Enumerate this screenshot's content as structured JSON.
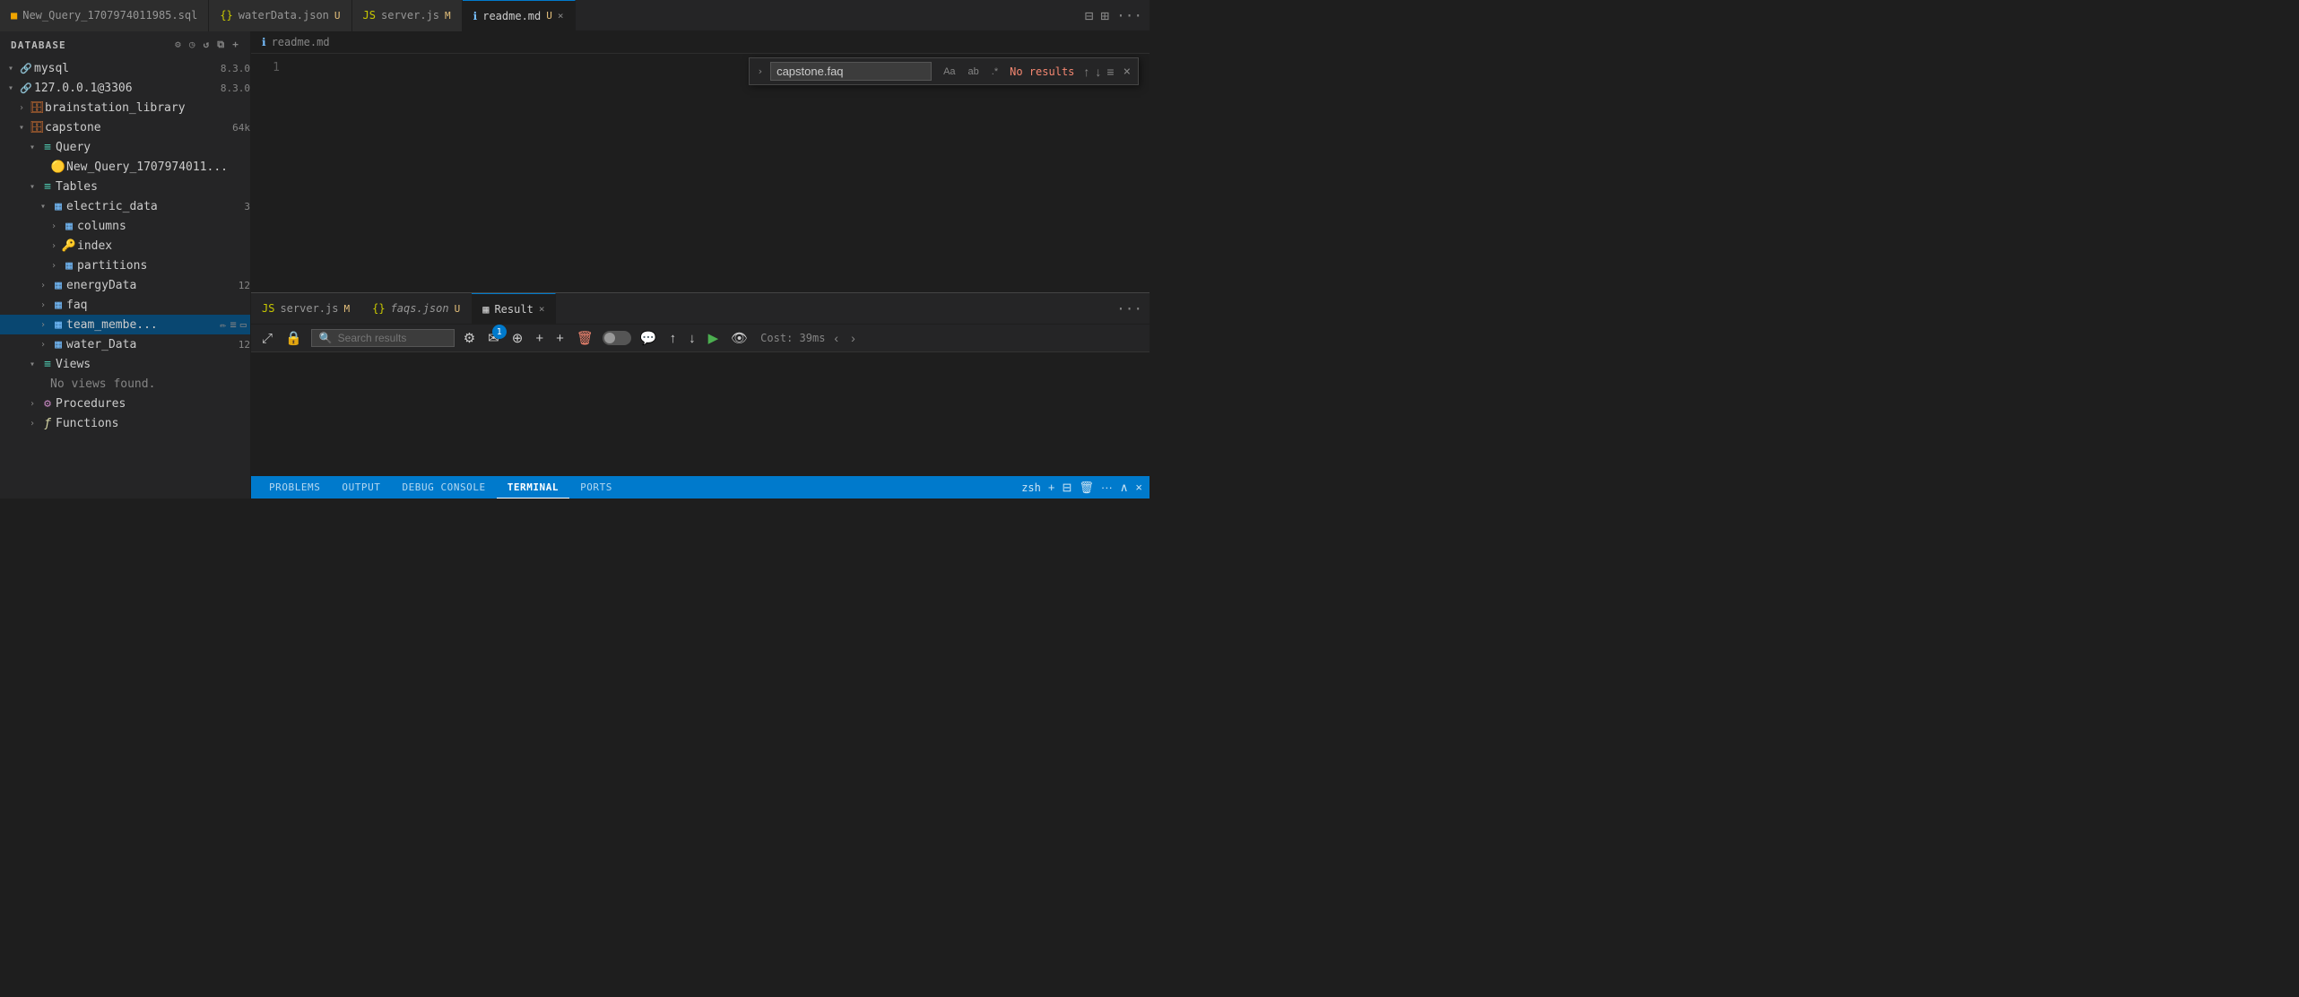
{
  "header": {
    "title": "DATABASE"
  },
  "tabs": [
    {
      "id": "sql-tab",
      "icon": "sql",
      "label": "New_Query_1707974011985.sql",
      "modified": false,
      "active": false
    },
    {
      "id": "json-tab",
      "icon": "json",
      "label": "waterData.json",
      "modified": true,
      "badge": "U",
      "active": false
    },
    {
      "id": "js-tab",
      "icon": "js",
      "label": "server.js",
      "modified": true,
      "badge": "M",
      "active": false
    },
    {
      "id": "readme-tab",
      "icon": "info",
      "label": "readme.md",
      "modified": true,
      "badge": "U",
      "active": true,
      "closable": true
    }
  ],
  "breadcrumb": {
    "icon": "info",
    "text": "readme.md"
  },
  "find_widget": {
    "expand_icon": "›",
    "search_value": "capstone.faq",
    "match_case_label": "Aa",
    "match_word_label": "ab",
    "regex_label": ".*",
    "result_text": "No results",
    "prev_label": "↑",
    "next_label": "↓",
    "list_label": "≡",
    "close_label": "×"
  },
  "editor": {
    "line_1": "1"
  },
  "sidebar": {
    "title": "DATABASE",
    "icons": [
      "⚙",
      "◷",
      "↺",
      "⧉",
      "+"
    ],
    "tree": [
      {
        "level": 0,
        "chevron": "open",
        "icon": "🔗",
        "icon_color": "mysql",
        "label": "mysql",
        "badge": "8.3.0"
      },
      {
        "level": 0,
        "chevron": "open",
        "icon": "🔗",
        "icon_color": "mysql",
        "label": "127.0.0.1@3306",
        "badge": "8.3.0"
      },
      {
        "level": 1,
        "chevron": "closed",
        "icon": "🗄",
        "icon_color": "db",
        "label": "brainstation_library",
        "badge": ""
      },
      {
        "level": 1,
        "chevron": "open",
        "icon": "🗄",
        "icon_color": "db",
        "label": "capstone",
        "badge": "64k"
      },
      {
        "level": 2,
        "chevron": "open",
        "icon": "≡",
        "icon_color": "view",
        "label": "Query",
        "badge": ""
      },
      {
        "level": 3,
        "chevron": "empty",
        "icon": "🟡",
        "icon_color": "query",
        "label": "New_Query_1707974011...",
        "badge": ""
      },
      {
        "level": 2,
        "chevron": "open",
        "icon": "≡",
        "icon_color": "view",
        "label": "Tables",
        "badge": ""
      },
      {
        "level": 3,
        "chevron": "open",
        "icon": "▦",
        "icon_color": "table",
        "label": "electric_data",
        "badge": "3"
      },
      {
        "level": 4,
        "chevron": "closed",
        "icon": "▦",
        "icon_color": "table",
        "label": "columns",
        "badge": ""
      },
      {
        "level": 4,
        "chevron": "closed",
        "icon": "🔑",
        "icon_color": "table",
        "label": "index",
        "badge": ""
      },
      {
        "level": 4,
        "chevron": "closed",
        "icon": "▦",
        "icon_color": "table",
        "label": "partitions",
        "badge": ""
      },
      {
        "level": 3,
        "chevron": "closed",
        "icon": "▦",
        "icon_color": "table",
        "label": "energyData",
        "badge": "12"
      },
      {
        "level": 3,
        "chevron": "closed",
        "icon": "▦",
        "icon_color": "table",
        "label": "faq",
        "badge": ""
      },
      {
        "level": 3,
        "chevron": "closed",
        "icon": "▦",
        "icon_color": "table",
        "label": "team_membe...",
        "badge": "",
        "selected": true,
        "show_actions": true
      },
      {
        "level": 3,
        "chevron": "closed",
        "icon": "▦",
        "icon_color": "table",
        "label": "water_Data",
        "badge": "12"
      },
      {
        "level": 2,
        "chevron": "open",
        "icon": "≡",
        "icon_color": "view",
        "label": "Views",
        "badge": ""
      },
      {
        "level": 3,
        "chevron": "empty",
        "icon": "",
        "icon_color": "",
        "label": "No views found.",
        "badge": ""
      },
      {
        "level": 2,
        "chevron": "closed",
        "icon": "⚙",
        "icon_color": "proc",
        "label": "Procedures",
        "badge": ""
      },
      {
        "level": 2,
        "chevron": "closed",
        "icon": "ƒ",
        "icon_color": "func",
        "label": "Functions",
        "badge": ""
      }
    ]
  },
  "bottom_panel": {
    "tabs": [
      {
        "id": "server-js",
        "icon": "js",
        "label": "server.js",
        "badge": "M",
        "active": false
      },
      {
        "id": "faqs-json",
        "icon": "json",
        "label": "faqs.json",
        "badge": "U",
        "active": false,
        "italic": true
      },
      {
        "id": "result",
        "icon": "result",
        "label": "Result",
        "active": true,
        "closable": true
      }
    ],
    "toolbar": {
      "move_icon": "⤢",
      "lock_icon": "🔒",
      "search_placeholder": "Search results",
      "settings_icon": "⚙",
      "email_icon": "✉",
      "badge_count": "1",
      "github_icon": "⊕",
      "add_icon_1": "+",
      "add_icon_2": "+",
      "delete_icon": "🗑",
      "toggle_label": "",
      "chat_icon": "💬",
      "up_icon": "↑",
      "down_icon": "↓",
      "play_icon": "▶",
      "eye_icon": "👁",
      "cost_text": "Cost: 39ms",
      "prev_icon": "‹",
      "next_icon": "›"
    },
    "status_tabs": [
      {
        "label": "PROBLEMS",
        "active": false
      },
      {
        "label": "OUTPUT",
        "active": false
      },
      {
        "label": "DEBUG CONSOLE",
        "active": false
      },
      {
        "label": "TERMINAL",
        "active": true
      },
      {
        "label": "PORTS",
        "active": false
      }
    ],
    "status_right": {
      "terminal_label": "zsh",
      "add_icon": "+",
      "split_icon": "⊞",
      "delete_icon": "🗑",
      "more_icon": "...",
      "up_icon": "∧",
      "close_icon": "×"
    }
  }
}
